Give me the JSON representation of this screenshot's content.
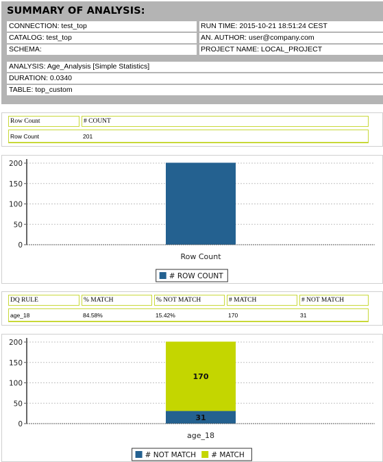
{
  "summary": {
    "title": "SUMMARY OF ANALYSIS:",
    "connection": "CONNECTION: test_top",
    "catalog": "CATALOG: test_top",
    "schema": "SCHEMA:",
    "run_time": "RUN TIME: 2015-10-21 18:51:24 CEST",
    "author": "AN. AUTHOR: user@company.com",
    "project": "PROJECT NAME: LOCAL_PROJECT",
    "analysis": "ANALYSIS: Age_Analysis [Simple Statistics]",
    "duration": "DURATION: 0.0340",
    "table": "TABLE: top_custom"
  },
  "row_count_table": {
    "headers": [
      "Row Count",
      "# COUNT"
    ],
    "rows": [
      [
        "Row Count",
        "201"
      ]
    ]
  },
  "dq_table": {
    "headers": [
      "DQ RULE",
      "% MATCH",
      "% NOT MATCH",
      "# MATCH",
      "# NOT MATCH"
    ],
    "rows": [
      [
        "age_18",
        "84.58%",
        "15.42%",
        "170",
        "31"
      ]
    ]
  },
  "colors": {
    "blue": "#246190",
    "lime": "#c4d600",
    "border_lime": "#c8d838",
    "summary_bg": "#b4b4b4"
  },
  "chart_data": [
    {
      "type": "bar",
      "title": "",
      "categories": [
        "Row Count"
      ],
      "series": [
        {
          "name": "# ROW COUNT",
          "values": [
            201
          ],
          "color": "#246190"
        }
      ],
      "yticks": [
        "0",
        "50",
        "100",
        "150",
        "200"
      ],
      "ylim": [
        0,
        200
      ],
      "grid": true,
      "legend": "bottom-center",
      "xlabel": "",
      "ylabel": ""
    },
    {
      "type": "bar",
      "stacked": true,
      "title": "",
      "categories": [
        "age_18"
      ],
      "series": [
        {
          "name": "# NOT MATCH",
          "values": [
            31
          ],
          "color": "#246190",
          "label": "31"
        },
        {
          "name": "# MATCH",
          "values": [
            170
          ],
          "color": "#c4d600",
          "label": "170"
        }
      ],
      "yticks": [
        "0",
        "50",
        "100",
        "150",
        "200"
      ],
      "ylim": [
        0,
        200
      ],
      "grid": true,
      "legend": "bottom-center",
      "xlabel": "",
      "ylabel": ""
    }
  ]
}
